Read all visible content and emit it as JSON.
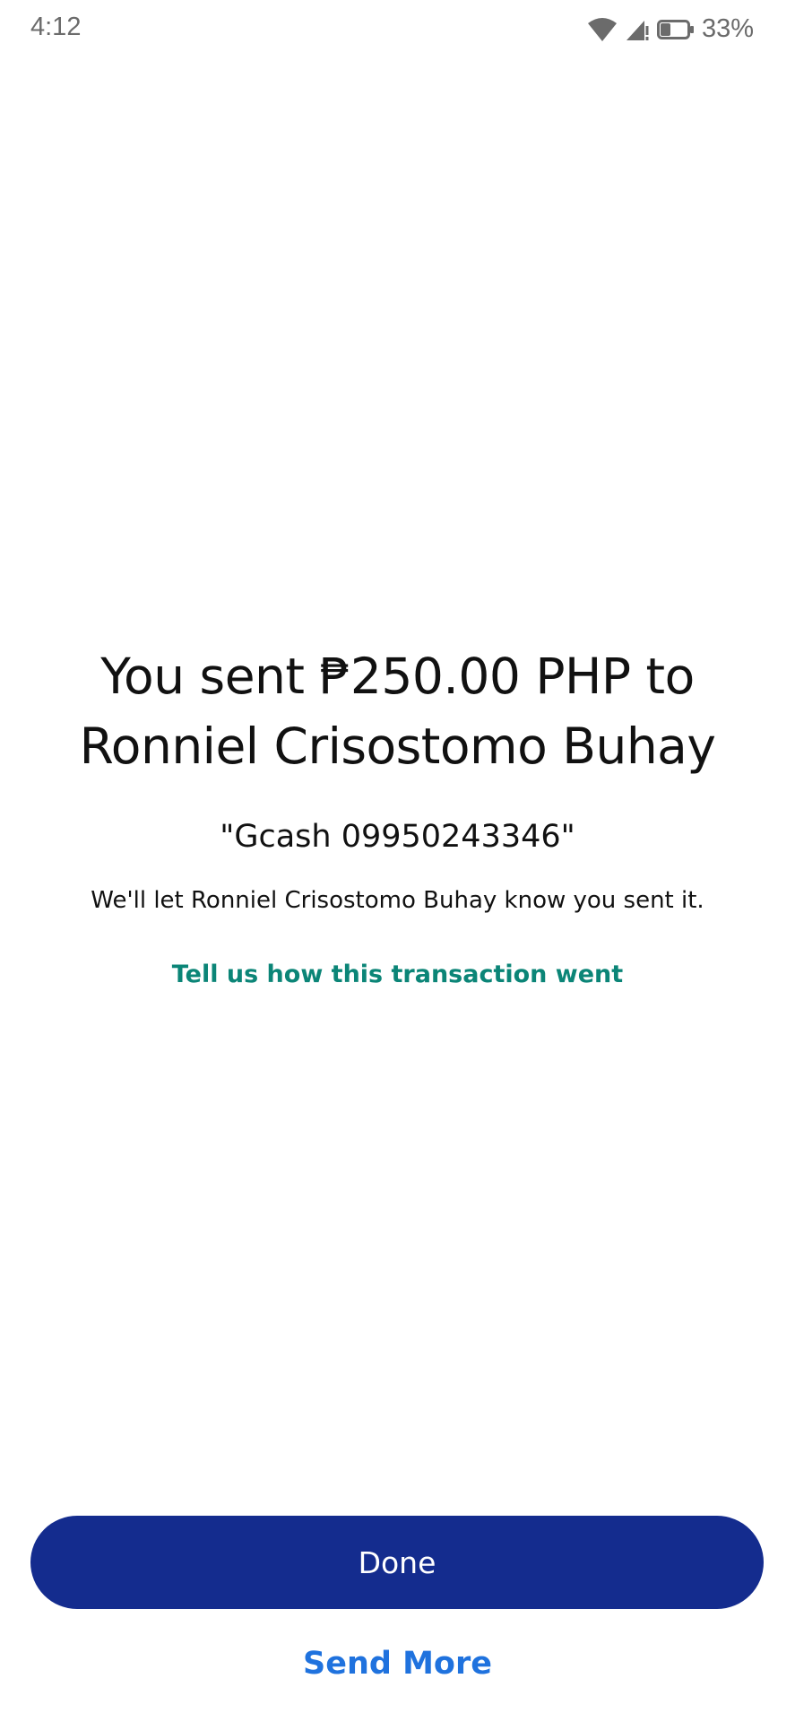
{
  "status_bar": {
    "time": "4:12",
    "battery_percent": "33%",
    "icons": [
      "wifi-icon",
      "cell-signal-icon",
      "battery-icon"
    ]
  },
  "confirmation": {
    "headline": "You sent ₱250.00 PHP to Ronniel Crisostomo Buhay",
    "note": "\"Gcash 09950243346\"",
    "subtext": "We'll let Ronniel Crisostomo Buhay know you sent it.",
    "feedback_link": "Tell us how this transaction went"
  },
  "actions": {
    "done_label": "Done",
    "send_more_label": "Send More"
  },
  "colors": {
    "primary_button": "#142c8e",
    "link_teal": "#0b8577",
    "link_blue": "#1f72de",
    "status_text": "#6b6b6b"
  }
}
